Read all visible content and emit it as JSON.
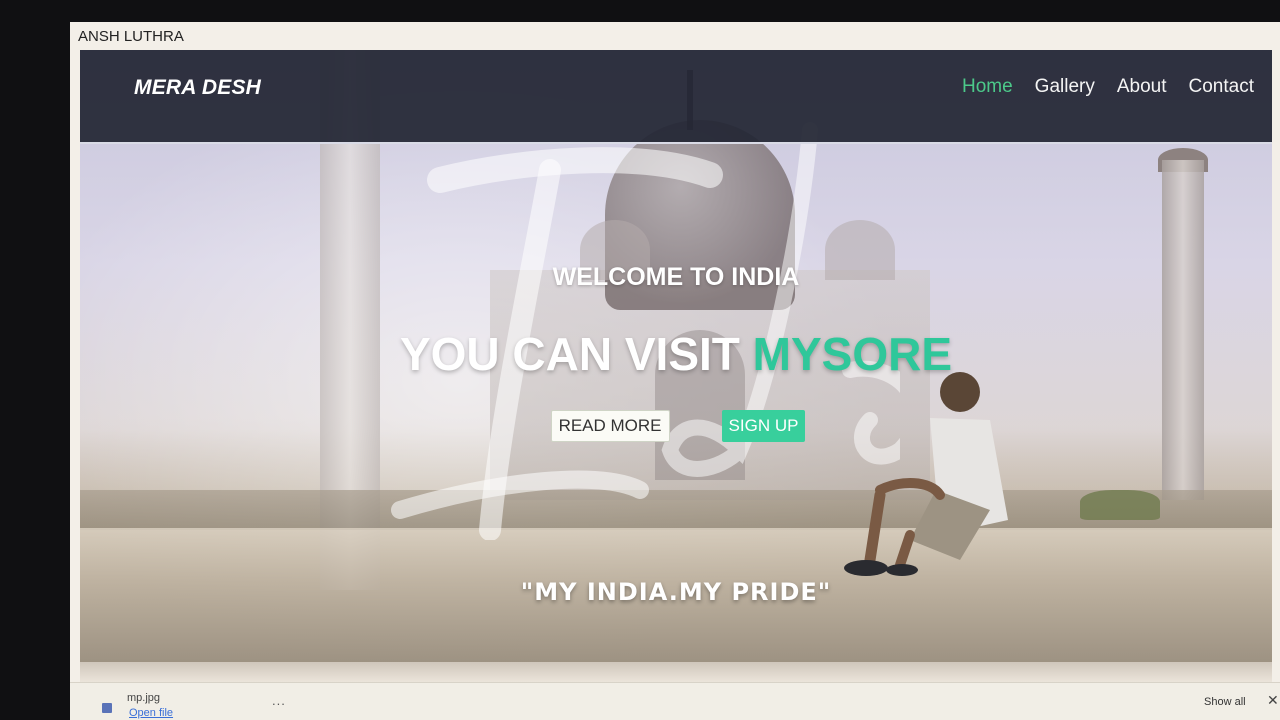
{
  "window": {
    "title": "ANSH LUTHRA"
  },
  "navbar": {
    "brand": "MERA DESH",
    "links": [
      {
        "label": "Home",
        "active": true
      },
      {
        "label": "Gallery",
        "active": false
      },
      {
        "label": "About",
        "active": false
      },
      {
        "label": "Contact",
        "active": false
      }
    ]
  },
  "hero": {
    "welcome": "WELCOME TO INDIA",
    "headline_prefix": "YOU CAN VISIT",
    "headline_accent": "MYSORE",
    "buttons": {
      "read_more": "READ MORE",
      "sign_up": "SIGN UP"
    },
    "motto": "\"MY INDIA.MY PRIDE\""
  },
  "download_bar": {
    "filename": "mp.jpg",
    "open_label": "Open file",
    "more_label": "...",
    "show_all_label": "Show all",
    "close_label": "✕"
  },
  "colors": {
    "nav_active": "#4cc98a",
    "accent": "#2fc79a",
    "signup_bg": "#38cf9c",
    "navbar_bg": "#222634"
  }
}
